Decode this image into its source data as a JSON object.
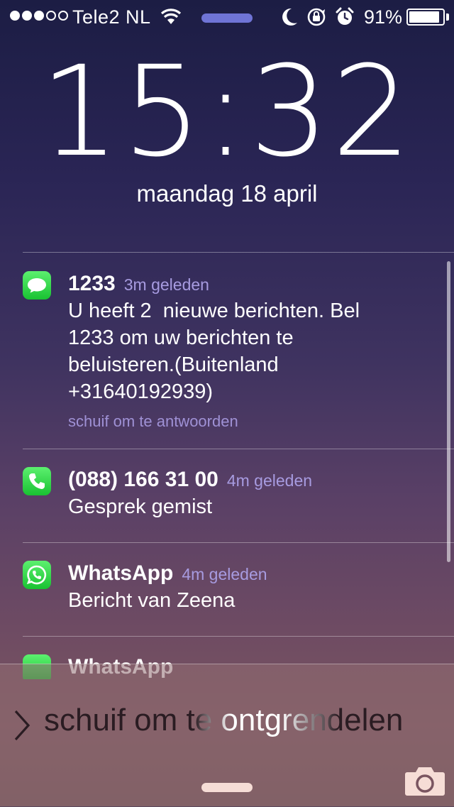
{
  "statusbar": {
    "carrier": "Tele2 NL",
    "battery_pct": "91%",
    "battery_level": 0.91
  },
  "lock": {
    "time": "15:32",
    "date": "maandag 18 april"
  },
  "notifications": [
    {
      "app_icon": "messages-icon",
      "title": "1233",
      "time": "3m geleden",
      "body_lines": [
        "U heeft 2  nieuwe berichten. Bel",
        "1233 om uw berichten te",
        "beluisteren.(Buitenland",
        "+31640192939)"
      ],
      "action": "schuif om te antwoorden"
    },
    {
      "app_icon": "phone-icon",
      "title": "(088) 166 31 00",
      "time": "4m geleden",
      "body_lines": [
        "Gesprek gemist"
      ]
    },
    {
      "app_icon": "whatsapp-icon",
      "title": "WhatsApp",
      "time": "4m geleden",
      "body_lines": [
        "Bericht van Zeena"
      ]
    },
    {
      "app_icon": "whatsapp-icon",
      "title": "WhatsApp"
    }
  ],
  "unlock": {
    "label": "schuif om te ontgrendelen"
  },
  "colors": {
    "accent_time": "#a79be0",
    "app_green": "#19c232",
    "pill": "#6f74d6"
  }
}
